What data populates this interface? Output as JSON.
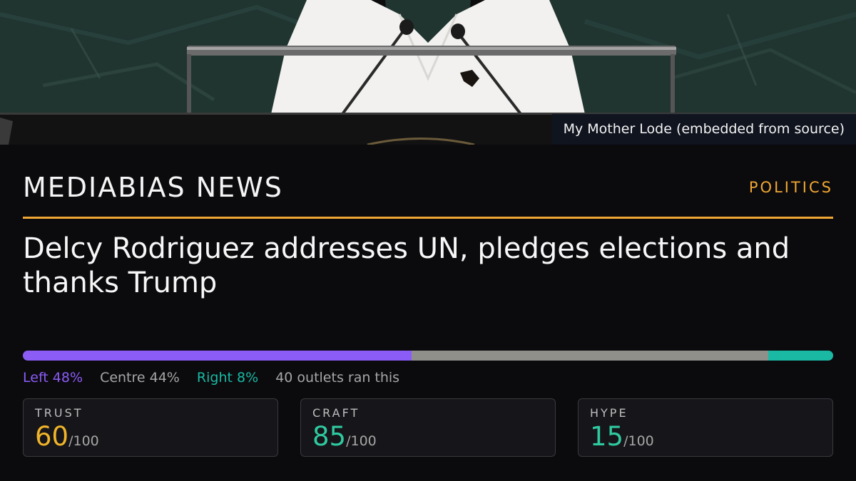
{
  "photo": {
    "caption": "My Mother Lode (embedded from source)"
  },
  "masthead": {
    "brand": "MEDIABIAS NEWS",
    "section": "POLITICS"
  },
  "article": {
    "headline": "Delcy Rodriguez addresses UN, pledges elections and thanks Trump"
  },
  "bias": {
    "left_pct": 48,
    "centre_pct": 44,
    "right_pct": 8,
    "left_label": "Left 48%",
    "centre_label": "Centre 44%",
    "right_label": "Right 8%",
    "outlets_label": "40 outlets ran this",
    "colors": {
      "left": "#8b5cf6",
      "centre": "#8f908a",
      "right": "#19b9a4"
    }
  },
  "scores": {
    "trust": {
      "label": "TRUST",
      "value": "60",
      "max": "/100",
      "color": "#f0b429"
    },
    "craft": {
      "label": "CRAFT",
      "value": "85",
      "max": "/100",
      "color": "#2fc9a0"
    },
    "hype": {
      "label": "HYPE",
      "value": "15",
      "max": "/100",
      "color": "#2fc9a0"
    }
  },
  "colors": {
    "accent": "#f0a733",
    "background": "#0b0a0d"
  }
}
